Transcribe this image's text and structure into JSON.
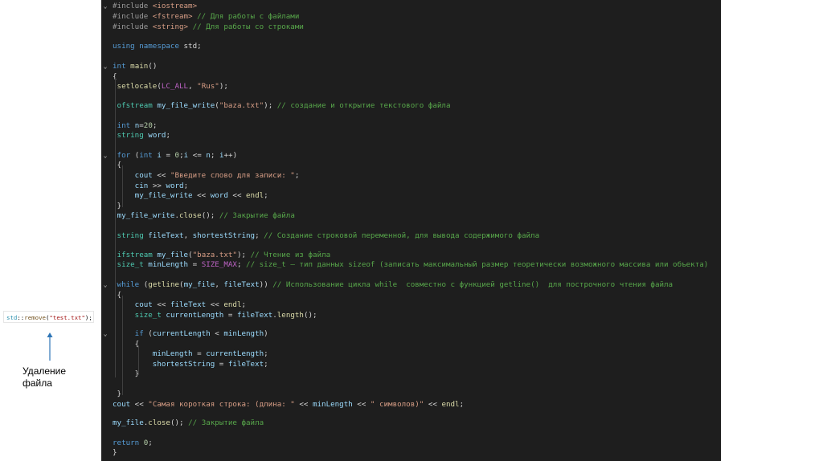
{
  "side_snippet": {
    "ns": "std",
    "sep": "::",
    "fn": "remove",
    "open": "(",
    "arg": "\"test.txt\"",
    "close": ");"
  },
  "caption": {
    "line1": "Удаление",
    "line2": "файла"
  },
  "lines": [
    {
      "fold": "⌄",
      "tokens": [
        [
          "pre",
          "#include "
        ],
        [
          "str",
          "<iostream>"
        ]
      ]
    },
    {
      "tokens": [
        [
          "pre",
          "#include "
        ],
        [
          "str",
          "<fstream>"
        ],
        [
          "cmt",
          " // Для работы с файлами"
        ]
      ]
    },
    {
      "tokens": [
        [
          "pre",
          "#include "
        ],
        [
          "str",
          "<string>"
        ],
        [
          "cmt",
          " // Для работы со строками"
        ]
      ]
    },
    {
      "tokens": [
        [
          "kw",
          "using namespace"
        ],
        [
          "t",
          " std;"
        ]
      ]
    },
    {
      "fold": "⌄",
      "tokens": [
        [
          "kw",
          "int"
        ],
        [
          "t",
          " "
        ],
        [
          "fn",
          "main"
        ],
        [
          "t",
          "()"
        ]
      ]
    },
    {
      "tokens": [
        [
          "t",
          "{"
        ]
      ]
    },
    {
      "tokens": [
        [
          "t",
          " "
        ],
        [
          "fn",
          "setlocale"
        ],
        [
          "t",
          "("
        ],
        [
          "mac",
          "LC_ALL"
        ],
        [
          "t",
          ", "
        ],
        [
          "str",
          "\"Rus\""
        ],
        [
          "t",
          ");"
        ]
      ]
    },
    {
      "tokens": [
        [
          "t",
          " "
        ],
        [
          "type",
          "ofstream"
        ],
        [
          "t",
          " "
        ],
        [
          "var",
          "my_file_write"
        ],
        [
          "t",
          "("
        ],
        [
          "str",
          "\"baza.txt\""
        ],
        [
          "t",
          "); "
        ],
        [
          "cmt",
          "// создание и открытие текстового файла"
        ]
      ]
    },
    {
      "tokens": [
        [
          "t",
          " "
        ],
        [
          "kw",
          "int"
        ],
        [
          "t",
          " "
        ],
        [
          "var",
          "n"
        ],
        [
          "t",
          "="
        ],
        [
          "num",
          "20"
        ],
        [
          "t",
          ";"
        ]
      ]
    },
    {
      "tokens": [
        [
          "t",
          " "
        ],
        [
          "type",
          "string"
        ],
        [
          "t",
          " "
        ],
        [
          "var",
          "word"
        ],
        [
          "t",
          ";"
        ]
      ]
    },
    {
      "fold": "⌄",
      "tokens": [
        [
          "t",
          " "
        ],
        [
          "kw",
          "for"
        ],
        [
          "t",
          " ("
        ],
        [
          "kw",
          "int"
        ],
        [
          "t",
          " "
        ],
        [
          "var",
          "i"
        ],
        [
          "t",
          " = "
        ],
        [
          "num",
          "0"
        ],
        [
          "t",
          ";"
        ],
        [
          "var",
          "i"
        ],
        [
          "t",
          " <= "
        ],
        [
          "var",
          "n"
        ],
        [
          "t",
          "; "
        ],
        [
          "var",
          "i"
        ],
        [
          "t",
          "++)"
        ]
      ]
    },
    {
      "tokens": [
        [
          "t",
          " {"
        ]
      ]
    },
    {
      "tokens": [
        [
          "t",
          "     "
        ],
        [
          "var",
          "cout"
        ],
        [
          "t",
          " << "
        ],
        [
          "str",
          "\"Введите слово для записи: \""
        ],
        [
          "t",
          ";"
        ]
      ]
    },
    {
      "tokens": [
        [
          "t",
          "     "
        ],
        [
          "var",
          "cin"
        ],
        [
          "t",
          " >> "
        ],
        [
          "var",
          "word"
        ],
        [
          "t",
          ";"
        ]
      ]
    },
    {
      "tokens": [
        [
          "t",
          "     "
        ],
        [
          "var",
          "my_file_write"
        ],
        [
          "t",
          " << "
        ],
        [
          "var",
          "word"
        ],
        [
          "t",
          " << "
        ],
        [
          "fn",
          "endl"
        ],
        [
          "t",
          ";"
        ]
      ]
    },
    {
      "tokens": [
        [
          "t",
          " }"
        ]
      ]
    },
    {
      "tokens": [
        [
          "t",
          " "
        ],
        [
          "var",
          "my_file_write"
        ],
        [
          "t",
          "."
        ],
        [
          "fn",
          "close"
        ],
        [
          "t",
          "(); "
        ],
        [
          "cmt",
          "// Закрытие файла"
        ]
      ]
    },
    {
      "tokens": [
        [
          "t",
          " "
        ],
        [
          "type",
          "string"
        ],
        [
          "t",
          " "
        ],
        [
          "var",
          "fileText"
        ],
        [
          "t",
          ", "
        ],
        [
          "var",
          "shortestString"
        ],
        [
          "t",
          "; "
        ],
        [
          "cmt",
          "// Создание строковой переменной, для вывода содержимого файла"
        ]
      ]
    },
    {
      "tokens": [
        [
          "t",
          " "
        ],
        [
          "type",
          "ifstream"
        ],
        [
          "t",
          " "
        ],
        [
          "var",
          "my_file"
        ],
        [
          "t",
          "("
        ],
        [
          "str",
          "\"baza.txt\""
        ],
        [
          "t",
          "); "
        ],
        [
          "cmt",
          "// Чтение из файла"
        ]
      ]
    },
    {
      "tokens": [
        [
          "t",
          " "
        ],
        [
          "type",
          "size_t"
        ],
        [
          "t",
          " "
        ],
        [
          "var",
          "minLength"
        ],
        [
          "t",
          " = "
        ],
        [
          "mac",
          "SIZE_MAX"
        ],
        [
          "t",
          "; "
        ],
        [
          "cmt",
          "// size_t – тип данных sizeof (записать максимальный размер теоретически возможного массива или объекта)"
        ]
      ]
    },
    {
      "fold": "⌄",
      "tokens": [
        [
          "t",
          " "
        ],
        [
          "kw",
          "while"
        ],
        [
          "t",
          " ("
        ],
        [
          "fn",
          "getline"
        ],
        [
          "t",
          "("
        ],
        [
          "var",
          "my_file"
        ],
        [
          "t",
          ", "
        ],
        [
          "var",
          "fileText"
        ],
        [
          "t",
          ")) "
        ],
        [
          "cmt",
          "// Использование цикла while  совместно с функцией getline()  для построчного чтения файла"
        ]
      ]
    },
    {
      "tokens": [
        [
          "t",
          " {"
        ]
      ]
    },
    {
      "tokens": [
        [
          "t",
          "     "
        ],
        [
          "var",
          "cout"
        ],
        [
          "t",
          " << "
        ],
        [
          "var",
          "fileText"
        ],
        [
          "t",
          " << "
        ],
        [
          "fn",
          "endl"
        ],
        [
          "t",
          ";"
        ]
      ]
    },
    {
      "tokens": [
        [
          "t",
          "     "
        ],
        [
          "type",
          "size_t"
        ],
        [
          "t",
          " "
        ],
        [
          "var",
          "currentLength"
        ],
        [
          "t",
          " = "
        ],
        [
          "var",
          "fileText"
        ],
        [
          "t",
          "."
        ],
        [
          "fn",
          "length"
        ],
        [
          "t",
          "();"
        ]
      ]
    },
    {
      "fold": "⌄",
      "tokens": [
        [
          "t",
          "     "
        ],
        [
          "kw",
          "if"
        ],
        [
          "t",
          " ("
        ],
        [
          "var",
          "currentLength"
        ],
        [
          "t",
          " < "
        ],
        [
          "var",
          "minLength"
        ],
        [
          "t",
          ")"
        ]
      ]
    },
    {
      "tokens": [
        [
          "t",
          "     {"
        ]
      ]
    },
    {
      "tokens": [
        [
          "t",
          "         "
        ],
        [
          "var",
          "minLength"
        ],
        [
          "t",
          " = "
        ],
        [
          "var",
          "currentLength"
        ],
        [
          "t",
          ";"
        ]
      ]
    },
    {
      "tokens": [
        [
          "t",
          "         "
        ],
        [
          "var",
          "shortestString"
        ],
        [
          "t",
          " = "
        ],
        [
          "var",
          "fileText"
        ],
        [
          "t",
          ";"
        ]
      ]
    },
    {
      "tokens": [
        [
          "t",
          "     }"
        ]
      ]
    },
    {
      "tokens": [
        [
          "t",
          " }"
        ]
      ]
    },
    {
      "tokens": [
        [
          "var",
          "cout"
        ],
        [
          "t",
          " << "
        ],
        [
          "str",
          "\"Самая короткая строка: (длина: \""
        ],
        [
          "t",
          " << "
        ],
        [
          "var",
          "minLength"
        ],
        [
          "t",
          " << "
        ],
        [
          "str",
          "\" символов)\""
        ],
        [
          "t",
          " << "
        ],
        [
          "fn",
          "endl"
        ],
        [
          "t",
          ";"
        ]
      ]
    },
    {
      "tokens": [
        [
          "var",
          "my_file"
        ],
        [
          "t",
          "."
        ],
        [
          "fn",
          "close"
        ],
        [
          "t",
          "(); "
        ],
        [
          "cmt",
          "// Закрытие файла"
        ]
      ]
    },
    {
      "tokens": [
        [
          "kw",
          "return"
        ],
        [
          "t",
          " "
        ],
        [
          "num",
          "0"
        ],
        [
          "t",
          ";"
        ]
      ]
    },
    {
      "tokens": [
        [
          "t",
          "}"
        ]
      ]
    }
  ]
}
